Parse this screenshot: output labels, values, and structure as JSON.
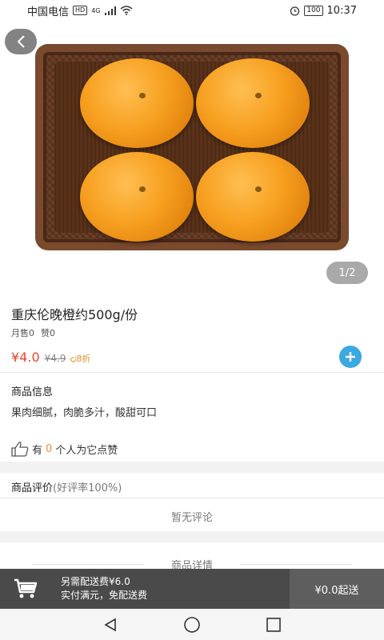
{
  "status_bar": {
    "carrier": "中国电信",
    "hd": "HD",
    "network": "4G",
    "battery": "100",
    "time": "10:37"
  },
  "hero": {
    "pager": "1/2",
    "back_icon": "chevron-left-icon"
  },
  "product": {
    "title": "重庆伦晚橙约500g/份",
    "monthly_sales": "月售0",
    "likes": "赞0",
    "price": "¥4.0",
    "original_price": "¥4.9",
    "discount": "8折"
  },
  "info": {
    "section_title": "商品信息",
    "description": "果肉细腻，肉脆多汁，酸甜可口",
    "like_prefix": "有",
    "like_count": "0",
    "like_suffix": "个人为它点赞"
  },
  "reviews": {
    "section_title": "商品评价",
    "rate": "(好评率100%)",
    "empty_text": "暂无评论"
  },
  "details": {
    "heading": "商品详情"
  },
  "cart_bar": {
    "delivery_fee": "另需配送费¥6.0",
    "free_delivery_note": "实付满元，免配送费",
    "min_order": "¥0.0起送"
  },
  "colors": {
    "price": "#e8452d",
    "accent": "#3aa9e0",
    "discount": "#e8932d",
    "cart_bar": "#4a4a4a"
  }
}
